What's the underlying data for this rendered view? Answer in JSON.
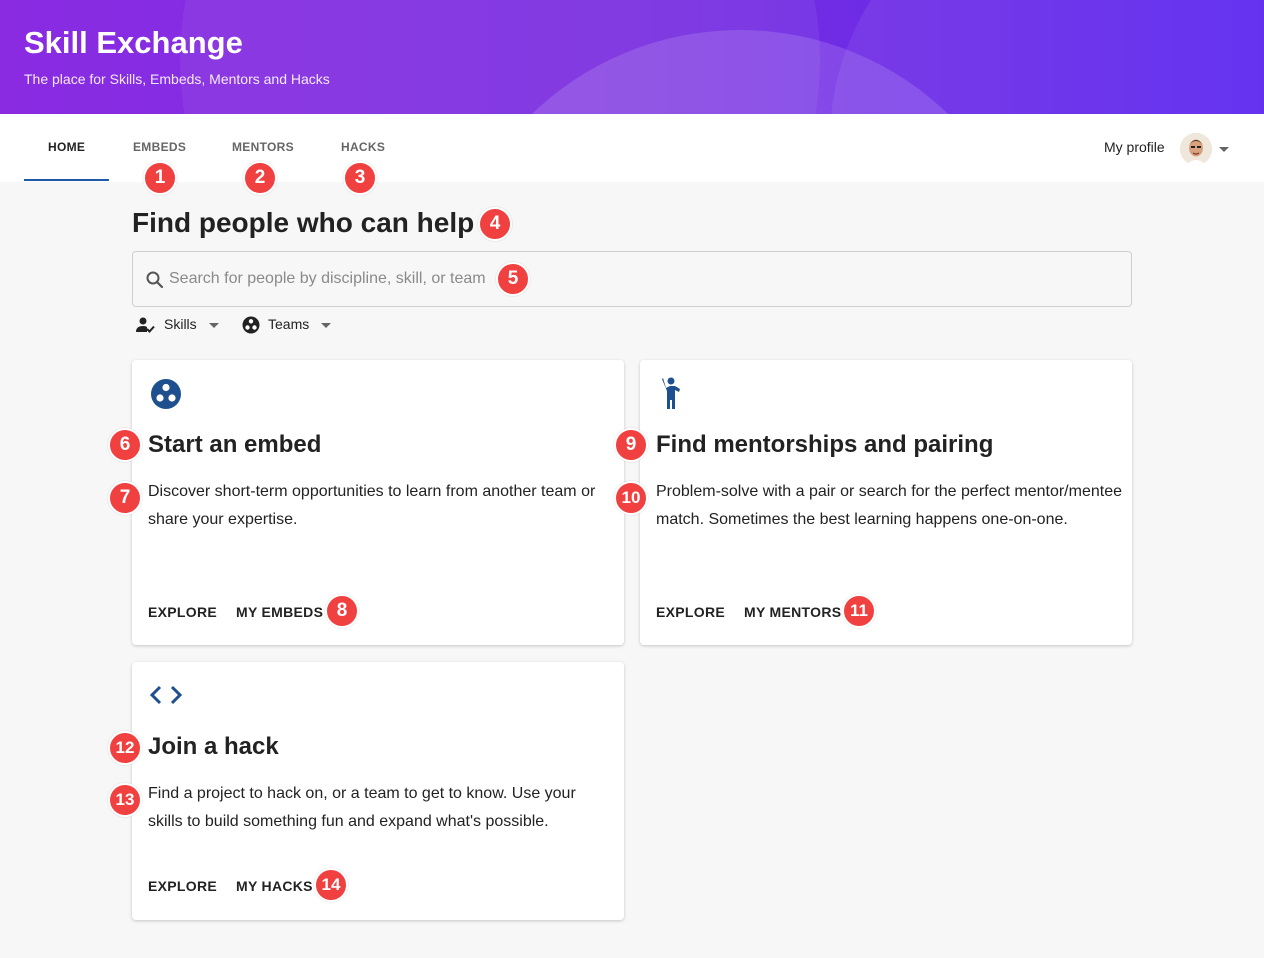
{
  "header": {
    "title": "Skill Exchange",
    "subtitle": "The place for Skills, Embeds, Mentors and Hacks"
  },
  "nav": {
    "tabs": [
      {
        "label": "HOME",
        "active": true
      },
      {
        "label": "EMBEDS"
      },
      {
        "label": "MENTORS"
      },
      {
        "label": "HACKS"
      }
    ],
    "profile_label": "My profile"
  },
  "main": {
    "heading": "Find people who can help",
    "search": {
      "placeholder": "Search for people by discipline, skill, or team",
      "value": ""
    },
    "filters": [
      {
        "label": "Skills",
        "icon": "person-check-icon"
      },
      {
        "label": "Teams",
        "icon": "team-icon"
      }
    ],
    "cards": [
      {
        "icon": "team-icon",
        "title": "Start an embed",
        "description": "Discover short-term opportunities to learn from another team or share your expertise.",
        "actions": [
          "EXPLORE",
          "MY EMBEDS"
        ]
      },
      {
        "icon": "person-raising-hand-icon",
        "title": "Find mentorships and pairing",
        "description": "Problem-solve with a pair or search for the perfect mentor/mentee match. Sometimes the best learning happens one-on-one.",
        "actions": [
          "EXPLORE",
          "MY MENTORS"
        ]
      },
      {
        "icon": "code-icon",
        "title": "Join a hack",
        "description": "Find a project to hack on, or a team to get to know. Use your skills to build something fun and expand what's possible.",
        "actions": [
          "EXPLORE",
          "MY HACKS"
        ]
      }
    ]
  },
  "annotations": [
    "1",
    "2",
    "3",
    "4",
    "5",
    "6",
    "7",
    "8",
    "9",
    "10",
    "11",
    "12",
    "13",
    "14"
  ],
  "colors": {
    "accent": "#1e5aa8",
    "badge": "#f04040",
    "hero_start": "#8a2be2",
    "hero_end": "#5a24ef"
  }
}
